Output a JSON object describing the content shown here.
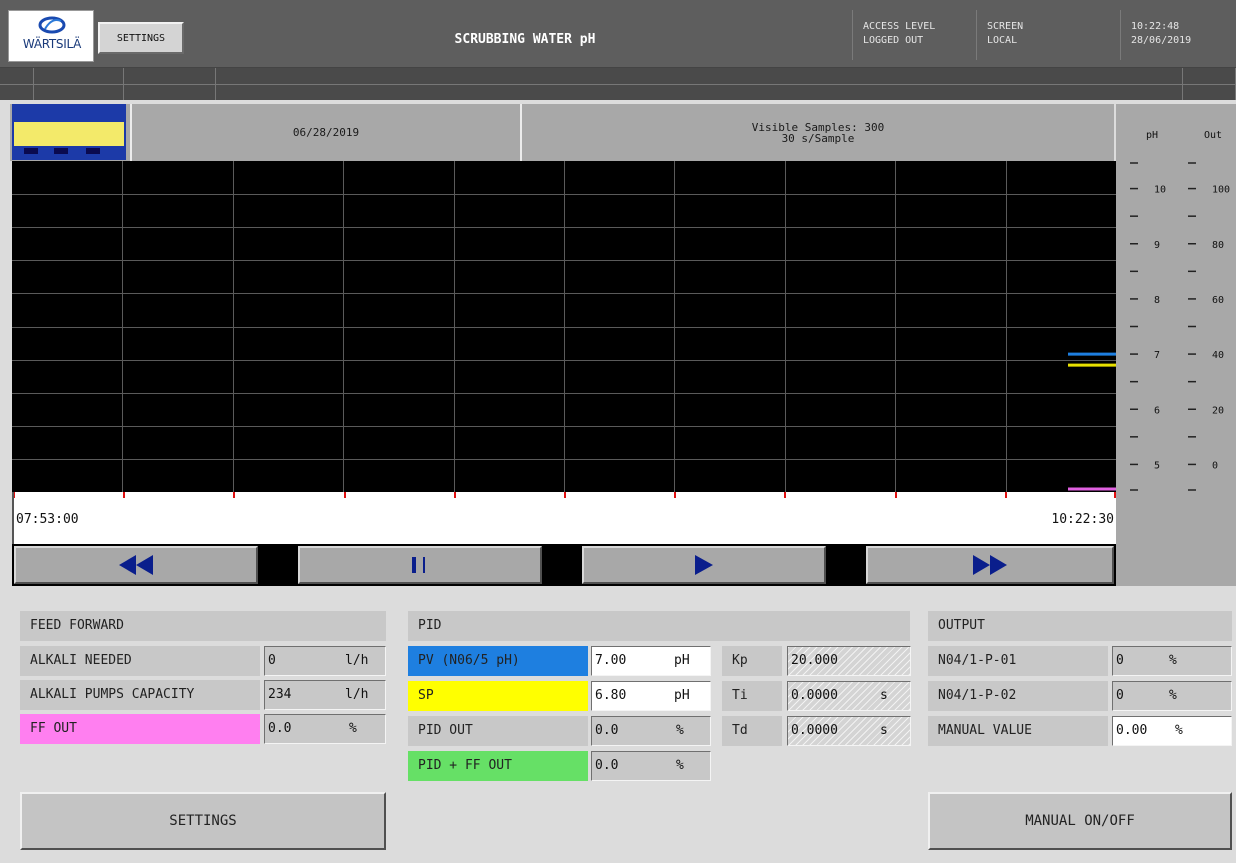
{
  "header": {
    "logo_text": "WÄRTSILÄ",
    "settings_label": "SETTINGS",
    "title": "SCRUBBING WATER pH",
    "access_label": "ACCESS LEVEL",
    "access_value": "LOGGED OUT",
    "screen_label": "SCREEN",
    "screen_value": "LOCAL",
    "time": "10:22:48",
    "date": "28/06/2019"
  },
  "trend": {
    "date": "06/28/2019",
    "samples_line1": "Visible Samples: 300",
    "samples_line2": "30 s/Sample",
    "time_start": "07:53:00",
    "time_end": "10:22:30",
    "scale_header_ph": "pH",
    "scale_header_out": "Out",
    "ph_ticks": [
      "10",
      "9",
      "8",
      "7",
      "6",
      "5"
    ],
    "out_ticks": [
      "100",
      "80",
      "60",
      "40",
      "20",
      "0"
    ],
    "ph_range": [
      4.5,
      10.5
    ],
    "out_range": [
      0,
      100
    ],
    "series": [
      {
        "color": "#1e7fe0",
        "value": 7.0,
        "axis": "ph"
      },
      {
        "color": "#e8e000",
        "value": 6.8,
        "axis": "ph"
      },
      {
        "color": "#e060e0",
        "value": 0.0,
        "axis": "out"
      }
    ],
    "nav": {
      "rewind_icon": "fast-rewind-icon",
      "pause_icon": "pause-icon",
      "play_icon": "play-icon",
      "forward_icon": "fast-forward-icon"
    }
  },
  "feed_forward": {
    "title": "FEED FORWARD",
    "rows": [
      {
        "label": "ALKALI NEEDED",
        "value": "0",
        "unit": "l/h"
      },
      {
        "label": "ALKALI PUMPS CAPACITY",
        "value": "234",
        "unit": "l/h"
      },
      {
        "label": "FF OUT",
        "value": "0.0",
        "unit": "%"
      }
    ],
    "settings_label": "SETTINGS"
  },
  "pid": {
    "title": "PID",
    "rows": [
      {
        "label": "PV (N06/5 pH)",
        "value": "7.00",
        "unit": "pH"
      },
      {
        "label": "SP",
        "value": "6.80",
        "unit": "pH"
      },
      {
        "label": "PID OUT",
        "value": "0.0",
        "unit": "%"
      },
      {
        "label": "PID + FF OUT",
        "value": "0.0",
        "unit": "%"
      }
    ],
    "params": [
      {
        "label": "Kp",
        "value": "20.000",
        "unit": ""
      },
      {
        "label": "Ti",
        "value": "0.0000",
        "unit": "s"
      },
      {
        "label": "Td",
        "value": "0.0000",
        "unit": "s"
      }
    ]
  },
  "output": {
    "title": "OUTPUT",
    "rows": [
      {
        "label": "N04/1-P-01",
        "value": "0",
        "unit": "%"
      },
      {
        "label": "N04/1-P-02",
        "value": "0",
        "unit": "%"
      },
      {
        "label": "MANUAL VALUE",
        "value": "0.00",
        "unit": "%"
      }
    ],
    "manual_button": "MANUAL ON/OFF"
  },
  "colors": {
    "pv": "#1e7fe0",
    "sp": "#ffff00",
    "ff_out": "#ff7ff0",
    "pid_ff_out": "#66e066"
  }
}
